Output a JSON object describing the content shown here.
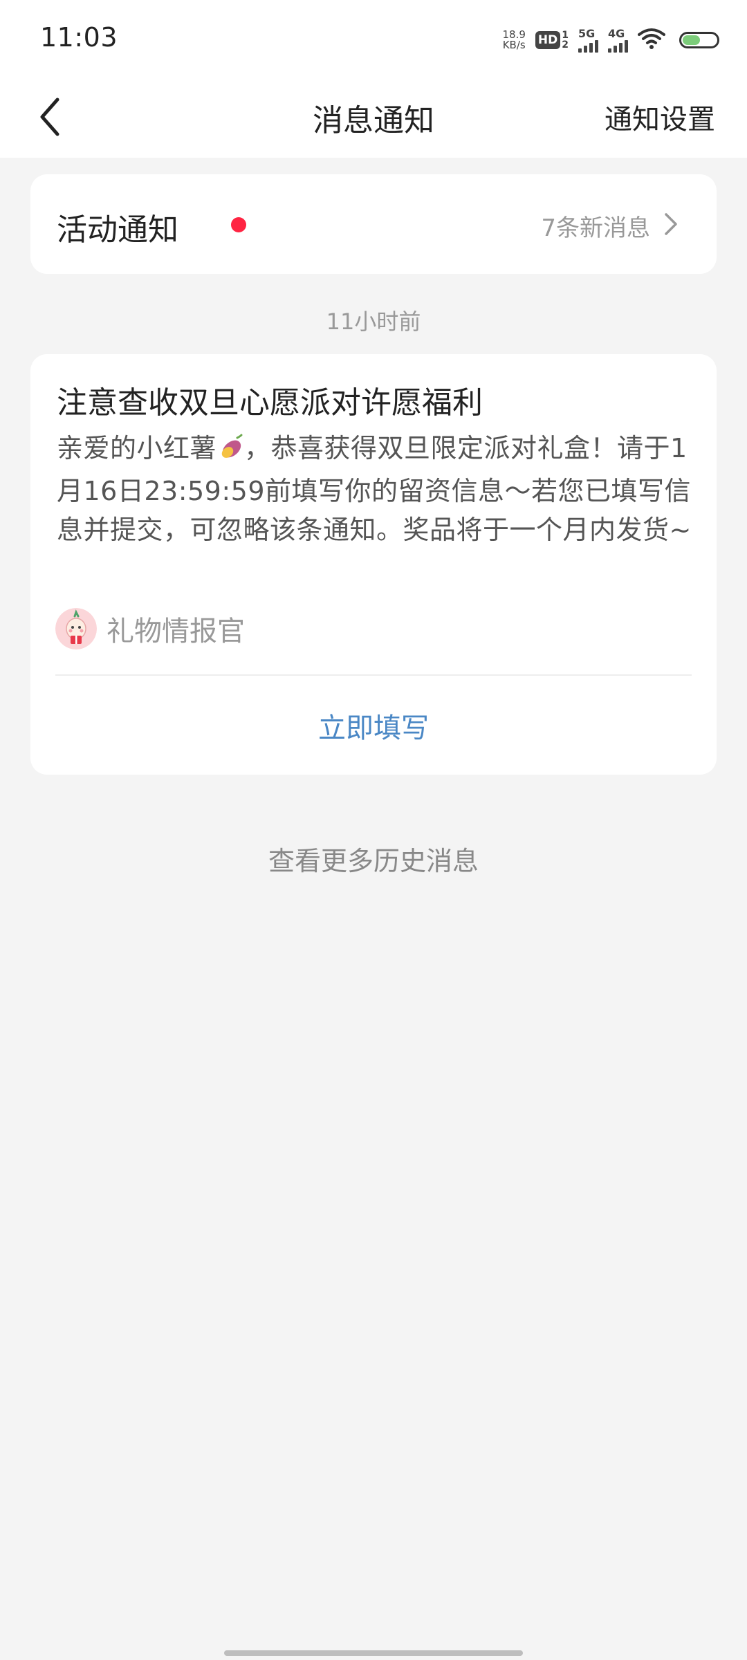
{
  "status_bar": {
    "time": "11:03",
    "net_speed_value": "18.9",
    "net_speed_unit": "KB/s",
    "hd_label": "HD",
    "hd_sub_top": "1",
    "hd_sub_bottom": "2",
    "sim1_label": "5G",
    "sim2_label": "4G",
    "battery_level": 0.55,
    "battery_color": "#7ccc7a"
  },
  "header": {
    "back_icon": "chevron-left-icon",
    "title": "消息通知",
    "settings_label": "通知设置"
  },
  "activity": {
    "title": "活动通知",
    "unread_dot_color": "#ff2442",
    "count_text": "7条新消息",
    "chevron_icon": "chevron-right-icon"
  },
  "timestamp": "11小时前",
  "message": {
    "title": "注意查收双旦心愿派对许愿福利",
    "body_part1": "亲爱的小红薯",
    "body_emoji": "sweet-potato-icon",
    "body_part2": "，恭喜获得双旦限定派对礼盒！请于1月16日23:59:59前填写你的留资信息～若您已填写信息并提交，可忽略该条通知。奖品将于一个月内发货~",
    "sender_name": "礼物情报官",
    "sender_avatar": "gift-mascot-avatar",
    "action_label": "立即填写",
    "action_color": "#4a87c5"
  },
  "history_link": "查看更多历史消息",
  "colors": {
    "background": "#f4f4f4",
    "card": "#ffffff",
    "accent_red": "#ff2442"
  }
}
